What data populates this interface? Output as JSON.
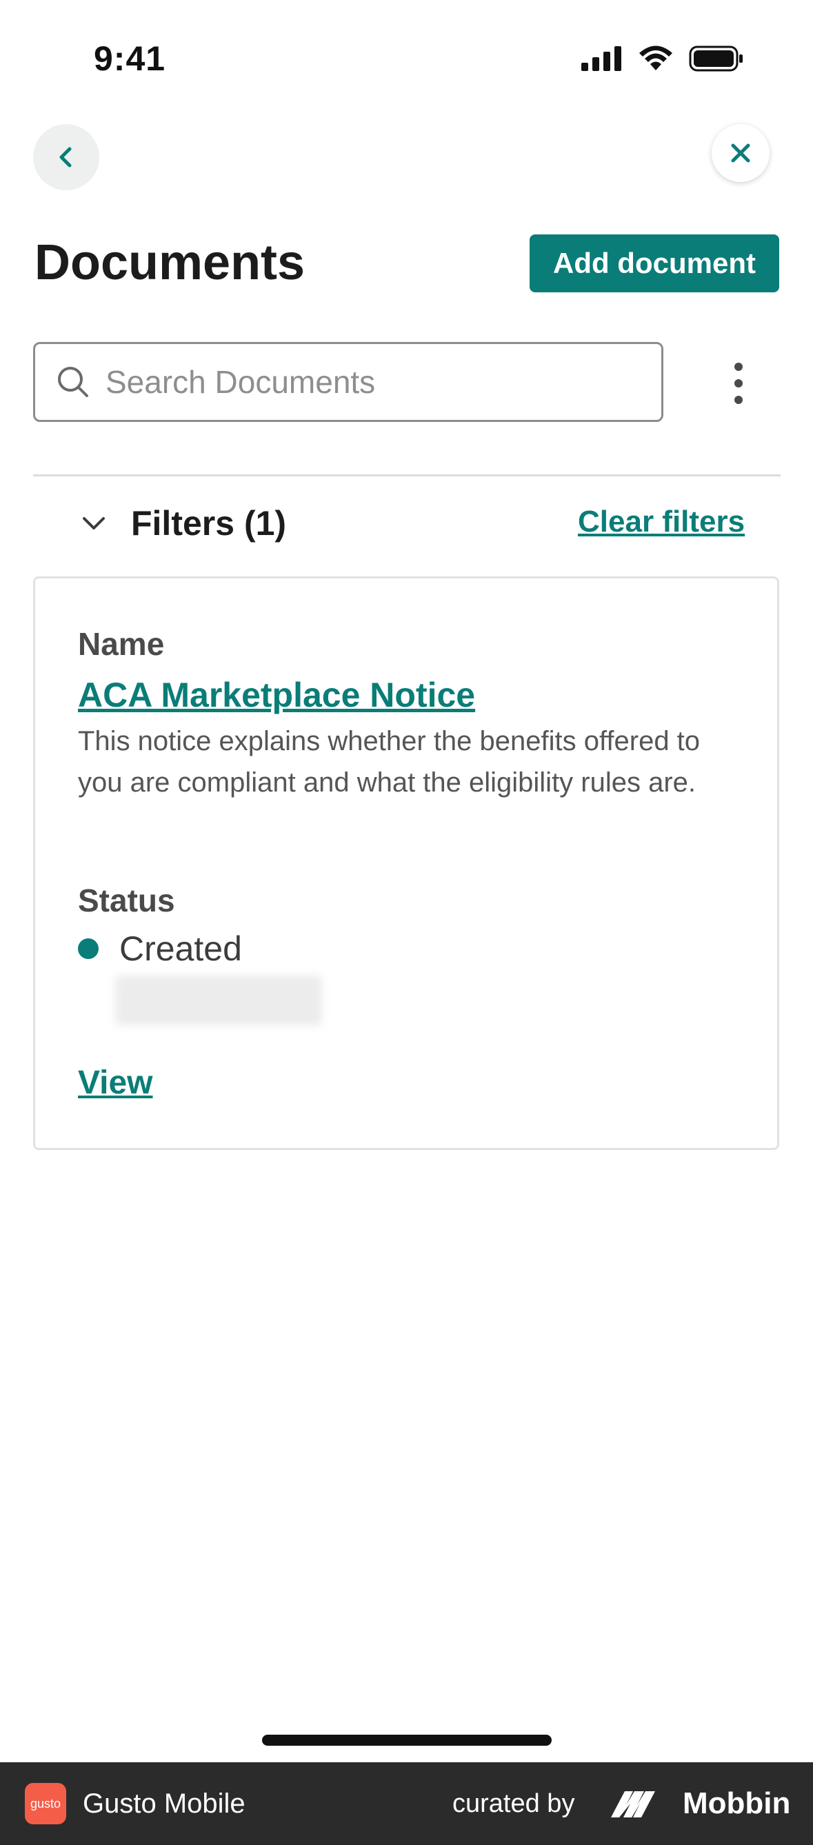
{
  "status_bar": {
    "time": "9:41"
  },
  "nav": {
    "back_icon": "chevron-left-icon",
    "close_icon": "close-icon"
  },
  "header": {
    "title": "Documents",
    "add_button": "Add document"
  },
  "search": {
    "placeholder": "Search Documents",
    "value": ""
  },
  "filters": {
    "label": "Filters (1)",
    "clear": "Clear filters"
  },
  "document_card": {
    "name_label": "Name",
    "name": "ACA Marketplace Notice",
    "description": "This notice explains whether the benefits offered to you are compliant and what the eligibility rules are.",
    "status_label": "Status",
    "status": "Created",
    "view_link": "View"
  },
  "footer": {
    "app_name": "Gusto Mobile",
    "app_icon_text": "gusto",
    "curated_by": "curated by",
    "brand": "Mobbin"
  },
  "colors": {
    "accent": "#0a7d78",
    "footer_bg": "#2b2b2b",
    "app_icon": "#f45d48"
  }
}
